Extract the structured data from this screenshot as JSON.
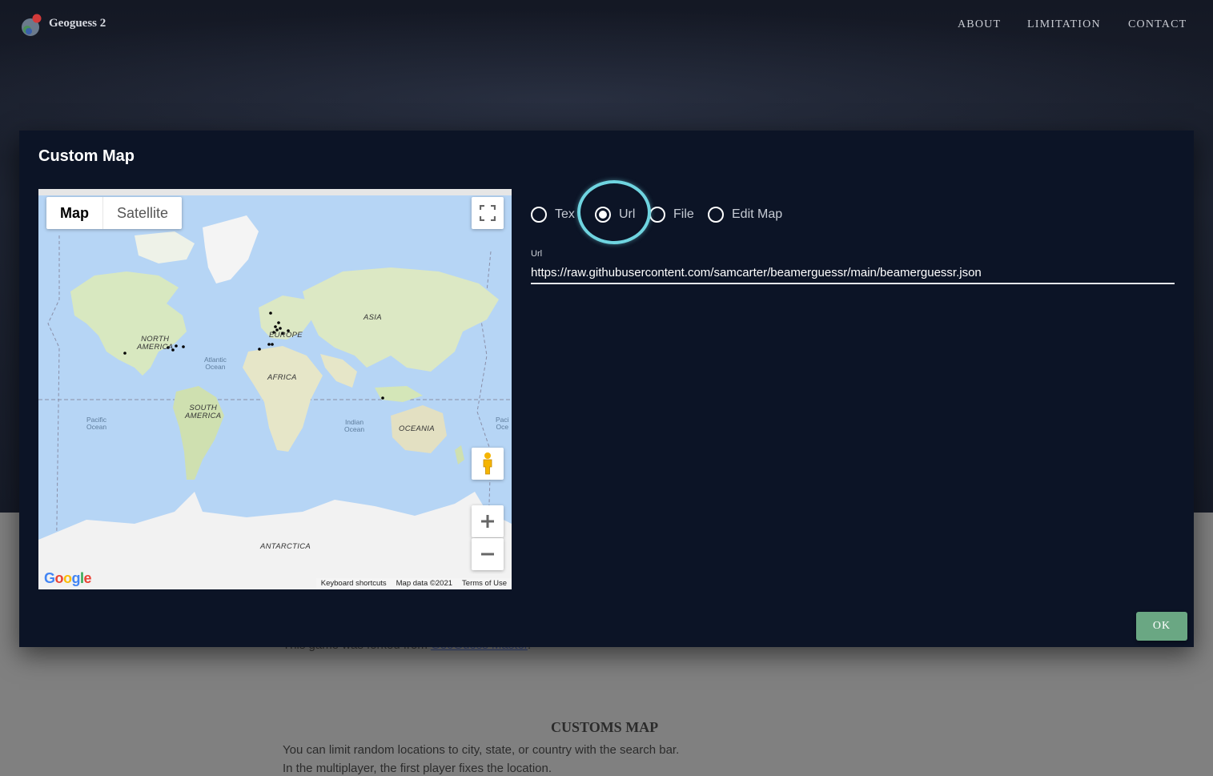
{
  "app": {
    "name": "Geoguess 2"
  },
  "nav": {
    "about": "ABOUT",
    "limitation": "LIMITATION",
    "contact": "CONTACT"
  },
  "background": {
    "forked_prefix": "This game was forked from ",
    "forked_link": "GeoGuess Master",
    "forked_suffix": ".",
    "customs_title": "CUSTOMS MAP",
    "customs_line1": "You can limit random locations to city, state, or country with the search bar.",
    "customs_line2": "In the multiplayer, the first player fixes the location."
  },
  "dialog": {
    "title": "Custom Map",
    "map": {
      "type_map": "Map",
      "type_satellite": "Satellite",
      "labels": {
        "north_america": "NORTH\nAMERICA",
        "europe": "EUROPE",
        "asia": "ASIA",
        "africa": "AFRICA",
        "south_america": "SOUTH\nAMERICA",
        "oceania": "OCEANIA",
        "antarctica": "ANTARCTICA",
        "atlantic": "Atlantic\nOcean",
        "pacific_left": "Pacific\nOcean",
        "indian": "Indian\nOcean",
        "pacific_right": "Paci\nOce"
      },
      "google": "Google",
      "attribution": {
        "shortcuts": "Keyboard shortcuts",
        "data": "Map data ©2021",
        "terms": "Terms of Use"
      }
    },
    "source_options": [
      {
        "label": "Tex",
        "selected": false
      },
      {
        "label": "Url",
        "selected": true
      },
      {
        "label": "File",
        "selected": false
      },
      {
        "label": "Edit Map",
        "selected": false
      }
    ],
    "url_field": {
      "label": "Url",
      "value": "https://raw.githubusercontent.com/samcarter/beamerguessr/main/beamerguessr.json"
    },
    "ok_label": "OK"
  },
  "colors": {
    "accent_ok": "#6aa783",
    "focus_ring": "#6fd4e0",
    "dialog_bg": "#0c1426"
  }
}
